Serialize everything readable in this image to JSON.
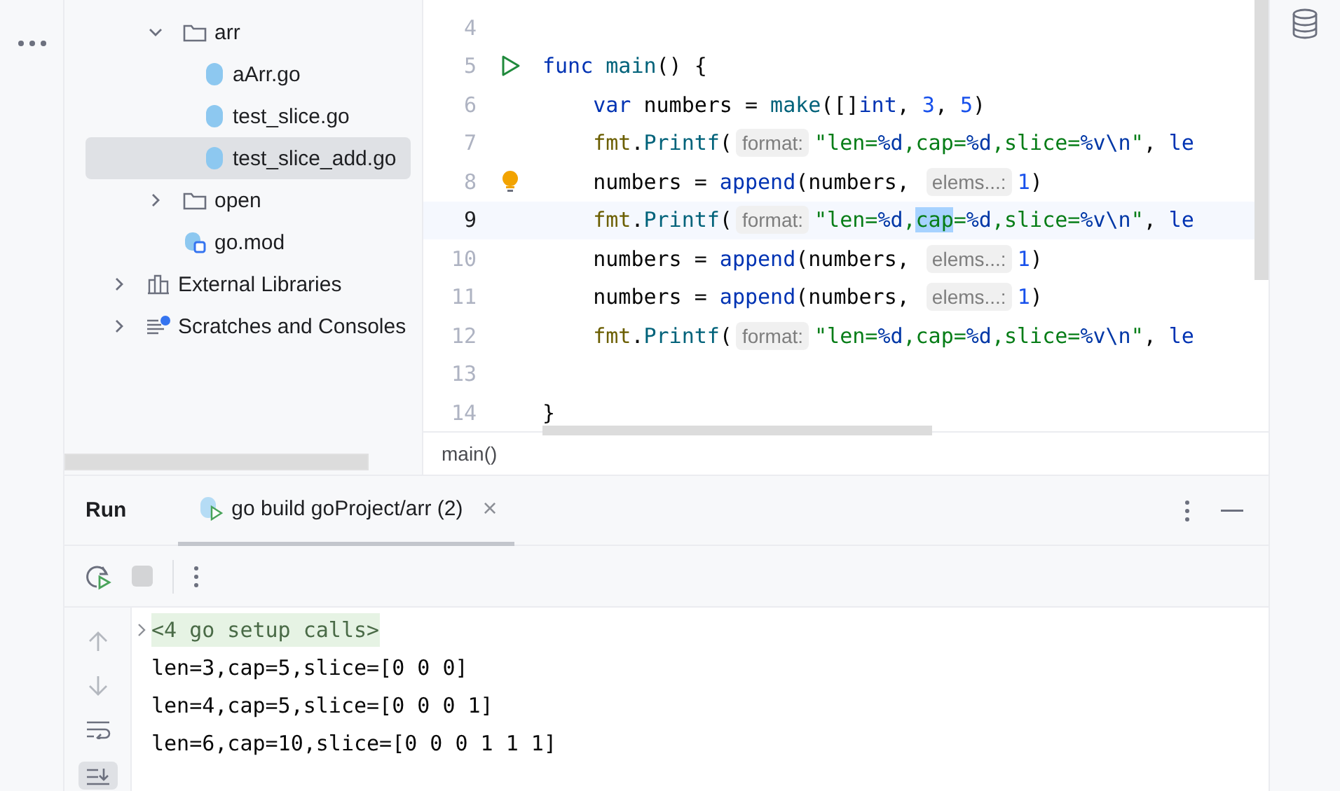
{
  "tree": {
    "project_items": [
      {
        "label": "arr",
        "kind": "folder",
        "expanded": true,
        "selected": false,
        "children": [
          {
            "label": "aArr.go",
            "kind": "go-file",
            "selected": false
          },
          {
            "label": "test_slice.go",
            "kind": "go-file",
            "selected": false
          },
          {
            "label": "test_slice_add.go",
            "kind": "go-file",
            "selected": true
          }
        ]
      },
      {
        "label": "open",
        "kind": "folder",
        "expanded": false,
        "selected": false
      },
      {
        "label": "go.mod",
        "kind": "go-mod",
        "selected": false
      }
    ],
    "root_items": [
      {
        "label": "External Libraries",
        "kind": "library",
        "expanded": false,
        "selected": false
      },
      {
        "label": "Scratches and Consoles",
        "kind": "scratches",
        "expanded": false,
        "selected": false
      }
    ]
  },
  "editor": {
    "lines": [
      {
        "number": "4",
        "current": false
      },
      {
        "number": "5",
        "current": false,
        "gutter": {
          "kind": "run"
        },
        "tokens": [
          {
            "kind": "kw",
            "text": "func"
          },
          {
            "kind": "fn",
            "text": "main",
            "space": true
          },
          {
            "kind": "plain",
            "text": "() {"
          }
        ]
      },
      {
        "number": "6",
        "current": false,
        "indent": true,
        "tokens": [
          {
            "kind": "kw",
            "text": "var"
          },
          {
            "kind": "plain",
            "text": " numbers = "
          },
          {
            "kind": "fn",
            "text": "make"
          },
          {
            "kind": "plain",
            "text": "([]"
          },
          {
            "kind": "kw",
            "text": "int"
          },
          {
            "kind": "plain",
            "text": ", "
          },
          {
            "kind": "num",
            "text": "3"
          },
          {
            "kind": "plain",
            "text": ", "
          },
          {
            "kind": "num",
            "text": "5"
          },
          {
            "kind": "plain",
            "text": ")"
          }
        ]
      },
      {
        "number": "7",
        "current": false,
        "indent": true,
        "tokens": [
          {
            "kind": "pkg",
            "text": "fmt"
          },
          {
            "kind": "plain",
            "text": "."
          },
          {
            "kind": "fn",
            "text": "Printf"
          },
          {
            "kind": "plain",
            "text": "("
          },
          {
            "kind": "hint",
            "text": "format:"
          },
          {
            "kind": "str",
            "text": "\"len="
          },
          {
            "kind": "esc",
            "text": "%d"
          },
          {
            "kind": "str",
            "text": ",cap="
          },
          {
            "kind": "esc",
            "text": "%d"
          },
          {
            "kind": "str",
            "text": ",slice="
          },
          {
            "kind": "esc",
            "text": "%v"
          },
          {
            "kind": "esc",
            "text": "\\n"
          },
          {
            "kind": "str",
            "text": "\""
          },
          {
            "kind": "plain",
            "text": ", "
          },
          {
            "kind": "kw",
            "text": "le"
          }
        ]
      },
      {
        "number": "8",
        "current": false,
        "indent": true,
        "gutter": {
          "kind": "bulb"
        },
        "tokens": [
          {
            "kind": "plain",
            "text": "numbers = "
          },
          {
            "kind": "kw",
            "text": "append"
          },
          {
            "kind": "plain",
            "text": "(numbers, "
          },
          {
            "kind": "hint",
            "text": "elems...:"
          },
          {
            "kind": "num",
            "text": "1"
          },
          {
            "kind": "plain",
            "text": ")"
          }
        ]
      },
      {
        "number": "9",
        "current": true,
        "indent": true,
        "tokens": [
          {
            "kind": "pkg",
            "text": "fmt"
          },
          {
            "kind": "plain",
            "text": "."
          },
          {
            "kind": "fn",
            "text": "Printf"
          },
          {
            "kind": "plain",
            "text": "("
          },
          {
            "kind": "hint",
            "text": "format:"
          },
          {
            "kind": "str",
            "text": "\"len="
          },
          {
            "kind": "esc",
            "text": "%d"
          },
          {
            "kind": "str",
            "text": ","
          },
          {
            "kind": "sel",
            "text": "cap"
          },
          {
            "kind": "str",
            "text": "="
          },
          {
            "kind": "esc",
            "text": "%d"
          },
          {
            "kind": "str",
            "text": ",slice="
          },
          {
            "kind": "esc",
            "text": "%v"
          },
          {
            "kind": "esc",
            "text": "\\n"
          },
          {
            "kind": "str",
            "text": "\""
          },
          {
            "kind": "plain",
            "text": ", "
          },
          {
            "kind": "kw",
            "text": "le"
          }
        ]
      },
      {
        "number": "10",
        "current": false,
        "indent": true,
        "tokens": [
          {
            "kind": "plain",
            "text": "numbers = "
          },
          {
            "kind": "kw",
            "text": "append"
          },
          {
            "kind": "plain",
            "text": "(numbers, "
          },
          {
            "kind": "hint",
            "text": "elems...:"
          },
          {
            "kind": "num",
            "text": "1"
          },
          {
            "kind": "plain",
            "text": ")"
          }
        ]
      },
      {
        "number": "11",
        "current": false,
        "indent": true,
        "tokens": [
          {
            "kind": "plain",
            "text": "numbers = "
          },
          {
            "kind": "kw",
            "text": "append"
          },
          {
            "kind": "plain",
            "text": "(numbers, "
          },
          {
            "kind": "hint",
            "text": "elems...:"
          },
          {
            "kind": "num",
            "text": "1"
          },
          {
            "kind": "plain",
            "text": ")"
          }
        ]
      },
      {
        "number": "12",
        "current": false,
        "indent": true,
        "tokens": [
          {
            "kind": "pkg",
            "text": "fmt"
          },
          {
            "kind": "plain",
            "text": "."
          },
          {
            "kind": "fn",
            "text": "Printf"
          },
          {
            "kind": "plain",
            "text": "("
          },
          {
            "kind": "hint",
            "text": "format:"
          },
          {
            "kind": "str",
            "text": "\"len="
          },
          {
            "kind": "esc",
            "text": "%d"
          },
          {
            "kind": "str",
            "text": ",cap="
          },
          {
            "kind": "esc",
            "text": "%d"
          },
          {
            "kind": "str",
            "text": ",slice="
          },
          {
            "kind": "esc",
            "text": "%v"
          },
          {
            "kind": "esc",
            "text": "\\n"
          },
          {
            "kind": "str",
            "text": "\""
          },
          {
            "kind": "plain",
            "text": ", "
          },
          {
            "kind": "kw",
            "text": "le"
          }
        ]
      },
      {
        "number": "13",
        "current": false
      },
      {
        "number": "14",
        "current": false,
        "tokens": [
          {
            "kind": "plain",
            "text": "}"
          }
        ]
      }
    ],
    "breadcrumb": "main()"
  },
  "run_panel": {
    "title": "Run",
    "tabs": [
      {
        "label": "go build goProject/arr (2)",
        "selected": true,
        "close": "×"
      }
    ],
    "console": [
      {
        "kind": "folded",
        "text": "<4 go setup calls>"
      },
      {
        "kind": "output",
        "text": "len=3,cap=5,slice=[0 0 0]"
      },
      {
        "kind": "output",
        "text": "len=4,cap=5,slice=[0 0 0 1]"
      },
      {
        "kind": "output",
        "text": "len=6,cap=10,slice=[0 0 0 1 1 1]"
      }
    ]
  }
}
